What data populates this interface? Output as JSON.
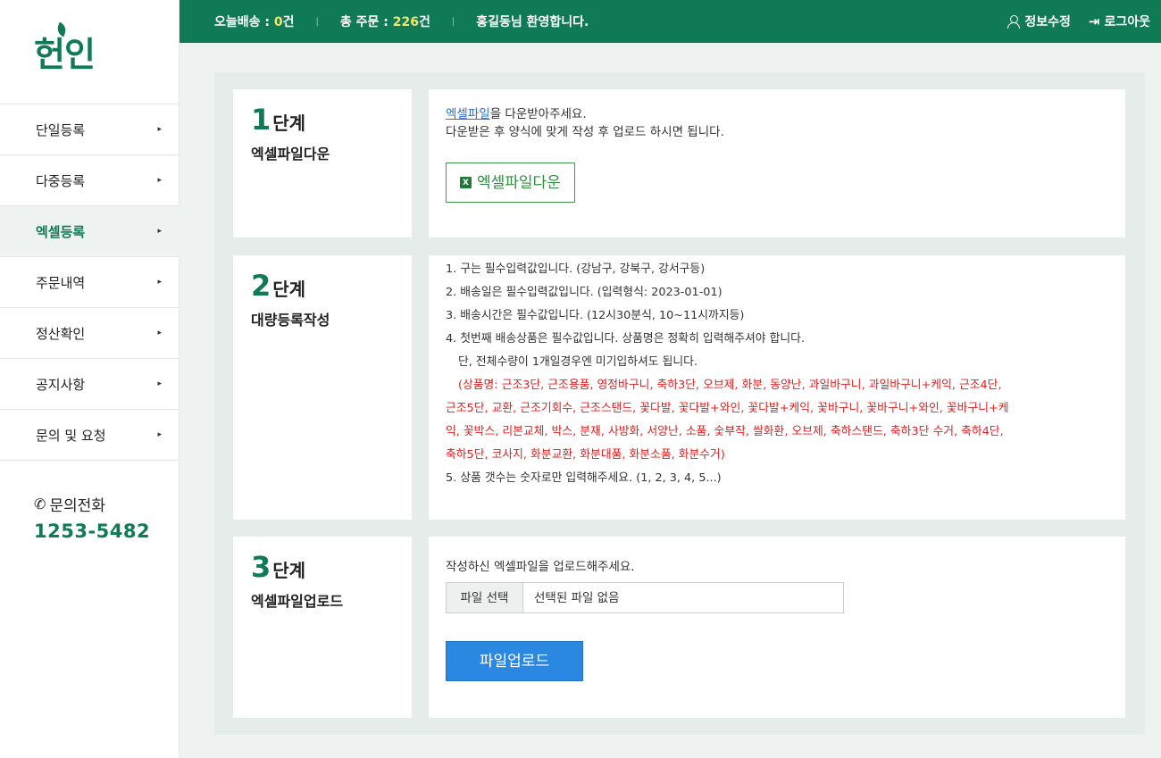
{
  "logo": "헌인",
  "topbar": {
    "today_label": "오늘배송 : ",
    "today_value": "0",
    "today_unit": "건",
    "total_label": "총 주문 : ",
    "total_value": "226",
    "total_unit": "건",
    "welcome": "홍길동님 환영합니다.",
    "edit_profile": "정보수정",
    "logout": "로그아웃"
  },
  "sidebar": {
    "items": [
      {
        "label": "단일등록"
      },
      {
        "label": "다중등록"
      },
      {
        "label": "엑셀등록"
      },
      {
        "label": "주문내역"
      },
      {
        "label": "정산확인"
      },
      {
        "label": "공지사항"
      },
      {
        "label": "문의 및 요청"
      }
    ],
    "arrow": "▸",
    "contact_label": "문의전화",
    "contact_number": "1253-5482"
  },
  "step1": {
    "num": "1",
    "word": "단계",
    "sub": "엑셀파일다운",
    "link_text": "엑셀파일",
    "line1_rest": "을 다운받아주세요.",
    "line2": "다운받은 후 양식에 맞게 작성 후 업로드 하시면 됩니다.",
    "button": "엑셀파일다운"
  },
  "step2": {
    "num": "2",
    "word": "단계",
    "sub": "대량등록작성",
    "note1": "1. 구는 필수입력값입니다. (강남구, 강북구, 강서구등)",
    "note2": "2. 배송일은 필수입력값입니다. (입력형식: 2023-01-01)",
    "note3": "3. 배송시간은 필수값입니다. (12시30분식, 10~11시까지등)",
    "note4": "4. 첫번째 배송상품은 필수값입니다. 상품명은 정확히 입력해주셔야 합니다.",
    "note4b": "단, 전체수량이 1개일경우엔 미기입하셔도 됩니다.",
    "red1": "(상품명: 근조3단, 근조용품, 영정바구니, 축하3단, 오브제, 화분, 동양난, 과일바구니, 과일바구니+케익, 근조4단,",
    "red2": "근조5단, 교환, 근조기회수, 근조스탠드, 꽃다발, 꽃다발+와인, 꽃다발+케익, 꽃바구니, 꽃바구니+와인, 꽃바구니+케",
    "red3": "익, 꽃박스, 리본교체, 박스, 분재, 사방화, 서양난, 소품, 숯부작, 쌀화환, 오브제, 축하스탠드, 축하3단 수거, 축하4단,",
    "red4": "축하5단, 코사지, 화분교환, 화분대품, 화분소품, 화분수거)",
    "note5": "5. 상품 갯수는 숫자로만 입력해주세요. (1, 2, 3, 4, 5...)"
  },
  "step3": {
    "num": "3",
    "word": "단계",
    "sub": "엑셀파일업로드",
    "instruction": "작성하신 엑셀파일을 업로드해주세요.",
    "file_button": "파일 선택",
    "file_status": "선택된 파일 없음",
    "upload_button": "파일업로드"
  },
  "colors": {
    "brand": "#0f7a55",
    "highlight": "#f8e36a",
    "warning": "#e02020",
    "primary_button": "#2b88e0"
  }
}
